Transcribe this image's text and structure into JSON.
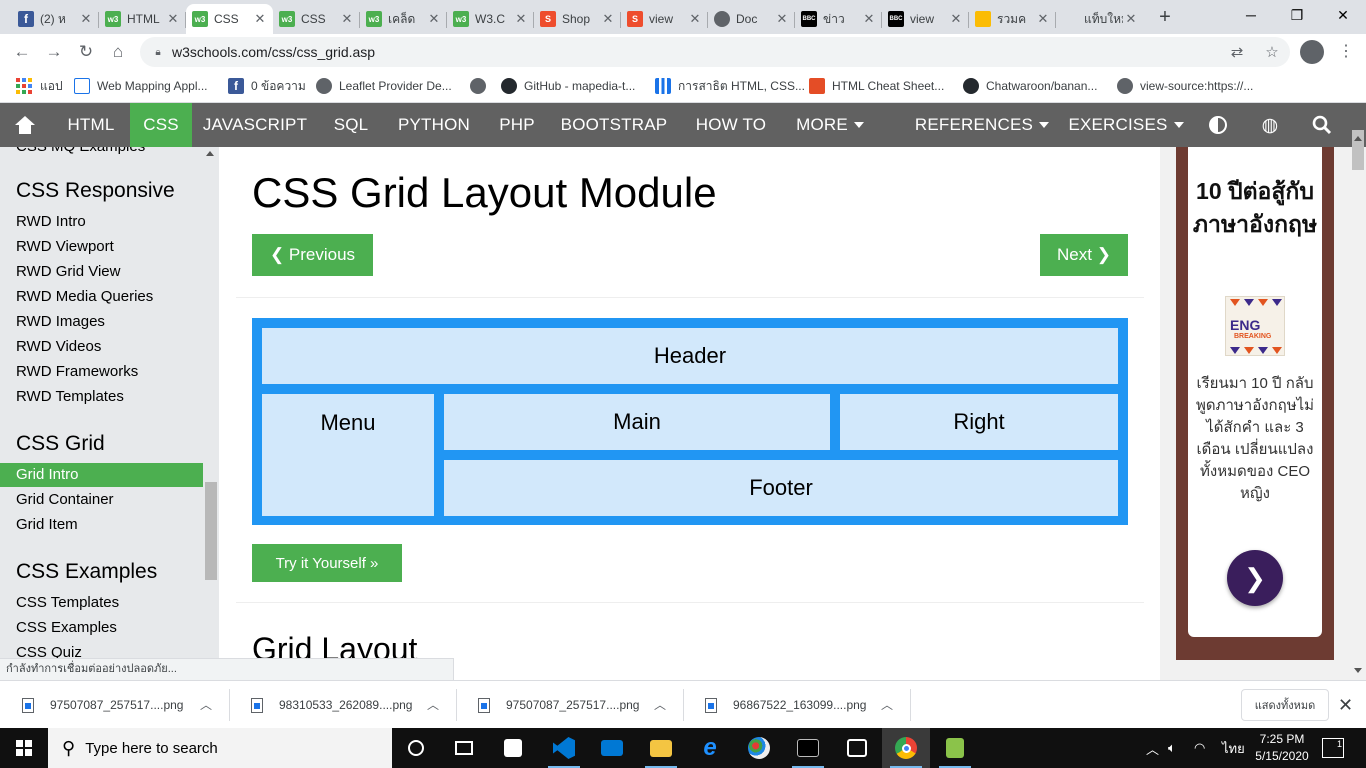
{
  "browser": {
    "tabs": [
      {
        "title": "(2) ห",
        "icon": "facebook-icon"
      },
      {
        "title": "HTML",
        "icon": "w3schools-icon"
      },
      {
        "title": "CSS",
        "icon": "w3schools-icon"
      },
      {
        "title": "CSS",
        "icon": "w3schools-icon"
      },
      {
        "title": "เคล็ด",
        "icon": "w3schools-icon"
      },
      {
        "title": "W3.C",
        "icon": "w3schools-icon"
      },
      {
        "title": "Shop",
        "icon": "shopee-icon"
      },
      {
        "title": "view",
        "icon": "shopee-icon"
      },
      {
        "title": "Doc",
        "icon": "globe-icon"
      },
      {
        "title": "ข่าว",
        "icon": "bbc-icon"
      },
      {
        "title": "view",
        "icon": "bbc-icon"
      },
      {
        "title": "รวมค",
        "icon": "document-icon"
      },
      {
        "title": "แท็บใหม่",
        "icon": "blank-icon"
      }
    ],
    "active_tab_index": 2,
    "url": "w3schools.com/css/css_grid.asp",
    "bookmarks": [
      {
        "label": "แอป",
        "icon": "apps-grid-icon"
      },
      {
        "label": "Web Mapping Appl...",
        "icon": "page-icon"
      },
      {
        "label": "0 ข้อความ",
        "icon": "facebook-icon"
      },
      {
        "label": "Leaflet Provider De...",
        "icon": "globe-icon"
      },
      {
        "label": "",
        "icon": "globe-icon"
      },
      {
        "label": "GitHub - mapedia-t...",
        "icon": "github-icon"
      },
      {
        "label": "การสาธิต HTML, CSS...",
        "icon": "bar-chart-icon"
      },
      {
        "label": "HTML Cheat Sheet...",
        "icon": "html5-icon"
      },
      {
        "label": "Chatwaroon/banan...",
        "icon": "github-icon"
      },
      {
        "label": "view-source:https://...",
        "icon": "globe-icon"
      }
    ],
    "status_text": "กำลังทำการเชื่อมต่ออย่างปลอดภัย..."
  },
  "nav": {
    "items": [
      "HTML",
      "CSS",
      "JAVASCRIPT",
      "SQL",
      "PYTHON",
      "PHP",
      "BOOTSTRAP",
      "HOW TO",
      "MORE",
      "REFERENCES",
      "EXERCISES"
    ],
    "active": "CSS"
  },
  "sidebar": {
    "partial_top": "CSS MQ Examples",
    "sections": [
      {
        "heading": "CSS Responsive",
        "items": [
          "RWD Intro",
          "RWD Viewport",
          "RWD Grid View",
          "RWD Media Queries",
          "RWD Images",
          "RWD Videos",
          "RWD Frameworks",
          "RWD Templates"
        ]
      },
      {
        "heading": "CSS Grid",
        "items": [
          "Grid Intro",
          "Grid Container",
          "Grid Item"
        ]
      },
      {
        "heading": "CSS Examples",
        "items": [
          "CSS Templates",
          "CSS Examples",
          "CSS Quiz"
        ]
      }
    ],
    "active_item": "Grid Intro"
  },
  "main": {
    "title": "CSS Grid Layout Module",
    "prev_label": "❮ Previous",
    "next_label": "Next ❯",
    "grid_demo": {
      "header": "Header",
      "menu": "Menu",
      "main": "Main",
      "right": "Right",
      "footer": "Footer"
    },
    "try_label": "Try it Yourself »",
    "section_heading": "Grid Layout"
  },
  "ad": {
    "heading": "10 ปีต่อสู้กับภาษาอังกฤษ",
    "logo_text": "ENG",
    "logo_sub": "BREAKING",
    "body": "เรียนมา 10 ปี กลับพูดภาษาอังกฤษไม่ได้สักคำ และ 3 เดือน เปลี่ยนแปลงทั้งหมดของ CEO หญิง",
    "button_symbol": "❯"
  },
  "downloads": {
    "files": [
      "97507087_257517....png",
      "98310533_262089....png",
      "97507087_257517....png",
      "96867522_163099....png"
    ],
    "show_all_label": "แสดงทั้งหมด"
  },
  "taskbar": {
    "search_placeholder": "Type here to search",
    "time": "7:25 PM",
    "date": "5/15/2020",
    "language": "ไทย",
    "notification_count": "1"
  },
  "colors": {
    "w3_green": "#4caf50",
    "nav_gray": "#616161",
    "grid_blue": "#2196f3",
    "grid_cell": "#d2e8fb"
  }
}
